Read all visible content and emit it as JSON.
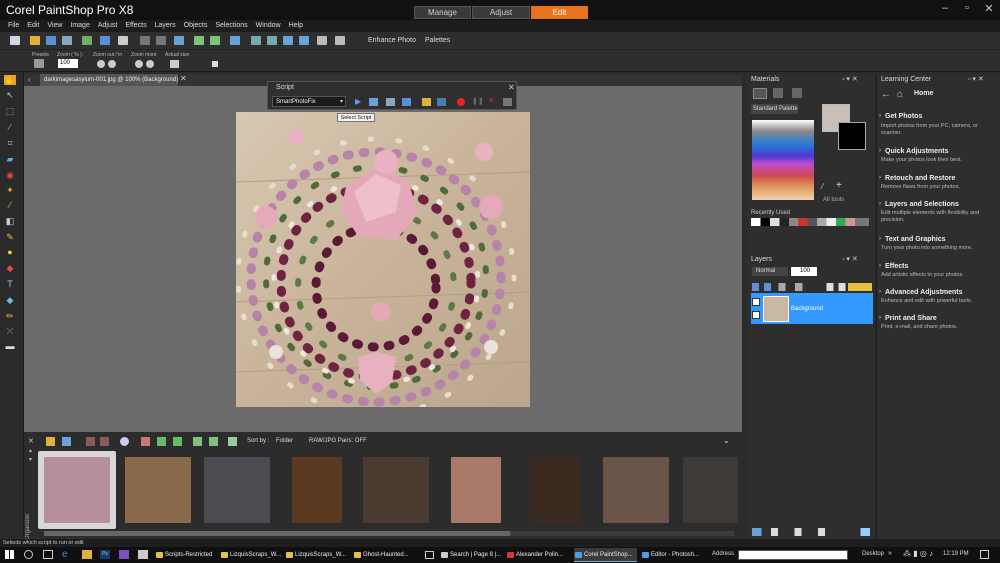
{
  "app": {
    "title": "Corel PaintShop Pro X8"
  },
  "modes": [
    {
      "label": "Manage"
    },
    {
      "label": "Adjust"
    },
    {
      "label": "Edit"
    }
  ],
  "menu": [
    "File",
    "Edit",
    "View",
    "Image",
    "Adjust",
    "Effects",
    "Layers",
    "Objects",
    "Selections",
    "Window",
    "Help"
  ],
  "toolbar": {
    "enhance_photo": "Enhance Photo",
    "palettes": "Palettes"
  },
  "tool_options": {
    "presets_label": "Presets",
    "zoom_label": "Zoom ( % ):",
    "zoom_value": "100",
    "zoom_out_in_label": "Zoom out / in",
    "zoom_more_label": "Zoom more",
    "actual_size_label": "Actual size"
  },
  "document": {
    "tab_title": "darkimagesasylum-001.jpg @ 100% (Background)"
  },
  "script_palette": {
    "title": "Script",
    "selected_script": "SmartPhotoFix",
    "tooltip": "Select Script"
  },
  "organizer": {
    "sort_by_label": "Sort by :",
    "sort_by_value": "Folder",
    "raw_jpg_pairs": "RAW/JPG Pairs: OFF",
    "side_label": "Organizer"
  },
  "materials": {
    "title": "Materials",
    "swatch_set": "Standard Palette",
    "all_tools": "All tools",
    "recently_used": "Recently Used"
  },
  "layers": {
    "title": "Layers",
    "blend_mode": "Normal",
    "opacity": "100",
    "layer_name": "Background"
  },
  "learning_center": {
    "title": "Learning Center",
    "home": "Home",
    "items": [
      {
        "title": "Get Photos",
        "desc": "Import photos from your PC, camera, or scanner."
      },
      {
        "title": "Quick Adjustments",
        "desc": "Make your photos look their best."
      },
      {
        "title": "Retouch and Restore",
        "desc": "Remove flaws from your photos."
      },
      {
        "title": "Layers and Selections",
        "desc": "Edit multiple elements with flexibility and precision."
      },
      {
        "title": "Text and Graphics",
        "desc": "Turn your photo into something more."
      },
      {
        "title": "Effects",
        "desc": "Add artistic effects to your photos."
      },
      {
        "title": "Advanced Adjustments",
        "desc": "Enhance and edit with powerful tools."
      },
      {
        "title": "Print and Share",
        "desc": "Print, e-mail, and share photos."
      }
    ]
  },
  "status_bar": {
    "text": "Selects which script to run or edit"
  },
  "taskbar": {
    "tasks": [
      "Scripts-Restricted",
      "LizquisScraps_W...",
      "LizquisScraps_W...",
      "Ghost-Haunted...",
      "Search | Page 8 |...",
      "Alexander Polin...",
      "Corel PaintShop...",
      "Editor - Photosh..."
    ],
    "address_label": "Address",
    "desktop_label": "Desktop",
    "time": "12:19 PM"
  },
  "colors": {
    "accent": "#e8731c",
    "selection": "#3399ff"
  }
}
